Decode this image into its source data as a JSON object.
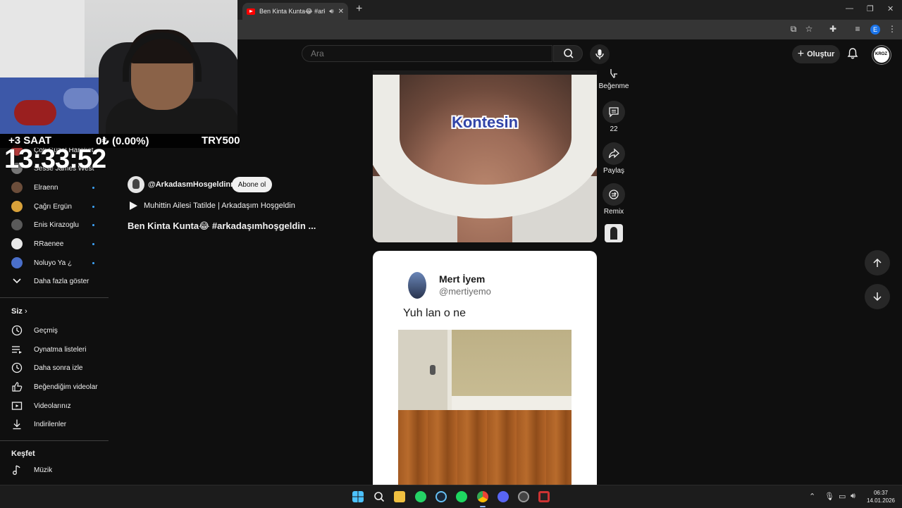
{
  "browser": {
    "tab_title": "Ben Kinta Kunta😂 #arkada",
    "new_tab_label": "+",
    "sound_icon": "speaker-icon",
    "close_tab_label": "✕"
  },
  "stream_overlay": {
    "timezone_label": "+3 SAAT",
    "change_label": "0₺ (0.00%)",
    "currency_label": "TRY500",
    "clock": "13:33:52"
  },
  "youtube_header": {
    "search_placeholder": "Ara",
    "create_label": "Oluştur"
  },
  "sidebar": {
    "subscriptions": [
      {
        "label": "Çok Güzel Hareket",
        "avatar_color": "#b23b3b",
        "new": false
      },
      {
        "label": "Sesse James West",
        "avatar_color": "#777777",
        "new": false
      },
      {
        "label": "Elraenn",
        "avatar_color": "#6b4d3a",
        "new": true
      },
      {
        "label": "Çağrı Ergün",
        "avatar_color": "#d8a13a",
        "new": true
      },
      {
        "label": "Enis Kirazoglu",
        "avatar_color": "#5a5a5a",
        "new": true
      },
      {
        "label": "RRaenee",
        "avatar_color": "#e8e8e8",
        "new": true
      },
      {
        "label": "Noluyo Ya ¿",
        "avatar_color": "#4a6fc9",
        "new": true
      }
    ],
    "show_more_label": "Daha fazla göster",
    "you_section": {
      "heading": "Siz",
      "items": [
        {
          "label": "Geçmiş",
          "icon": "history-icon"
        },
        {
          "label": "Oynatma listeleri",
          "icon": "playlists-icon"
        },
        {
          "label": "Daha sonra izle",
          "icon": "watch-later-icon"
        },
        {
          "label": "Beğendiğim videolar",
          "icon": "thumbs-up-icon"
        },
        {
          "label": "Videolarınız",
          "icon": "your-videos-icon"
        },
        {
          "label": "İndirilenler",
          "icon": "download-icon"
        }
      ]
    },
    "explore_section": {
      "heading": "Keşfet",
      "items": [
        {
          "label": "Müzik",
          "icon": "music-note-icon"
        }
      ]
    }
  },
  "short_info": {
    "channel_name": "@ArkadasmHosgeldinn",
    "subscribe_label": "Abone ol",
    "playlist_label": "Muhittin Ailesi Tatilde | Arkadaşım Hoşgeldin",
    "title": "Ben Kinta Kunta😂 #arkadaşımhoşgeldin ..."
  },
  "short1": {
    "caption": "Kontesin"
  },
  "actions": {
    "dislike_label": "Beğenme",
    "comments_count": "22",
    "share_label": "Paylaş",
    "remix_label": "Remix"
  },
  "short2": {
    "tweet_name": "Mert İyem",
    "tweet_handle": "@mertiyemo",
    "tweet_text": "Yuh lan o ne"
  },
  "taskbar": {
    "time": "06:37",
    "date": "14.01.2026"
  }
}
